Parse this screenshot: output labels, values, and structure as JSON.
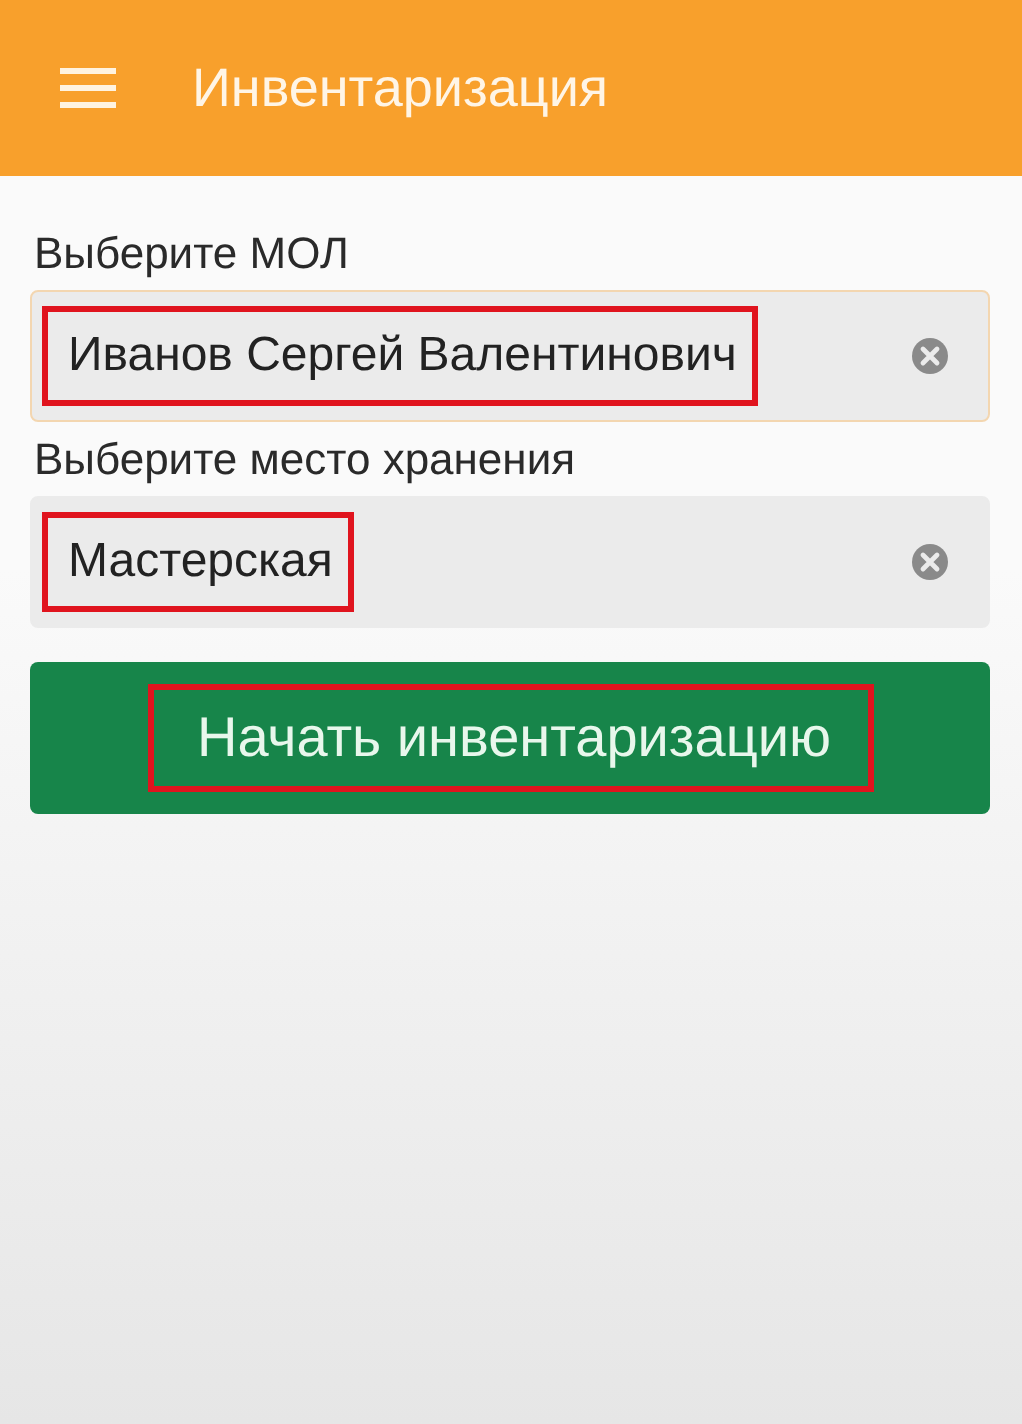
{
  "app_bar": {
    "title": "Инвентаризация"
  },
  "fields": [
    {
      "label": "Выберите МОЛ",
      "value": "Иванов Сергей Валентинович",
      "focused": true,
      "highlighted": true
    },
    {
      "label": "Выберите место хранения",
      "value": "Мастерская",
      "focused": false,
      "highlighted": true
    }
  ],
  "button": {
    "label": "Начать инвентаризацию",
    "highlighted": true
  }
}
